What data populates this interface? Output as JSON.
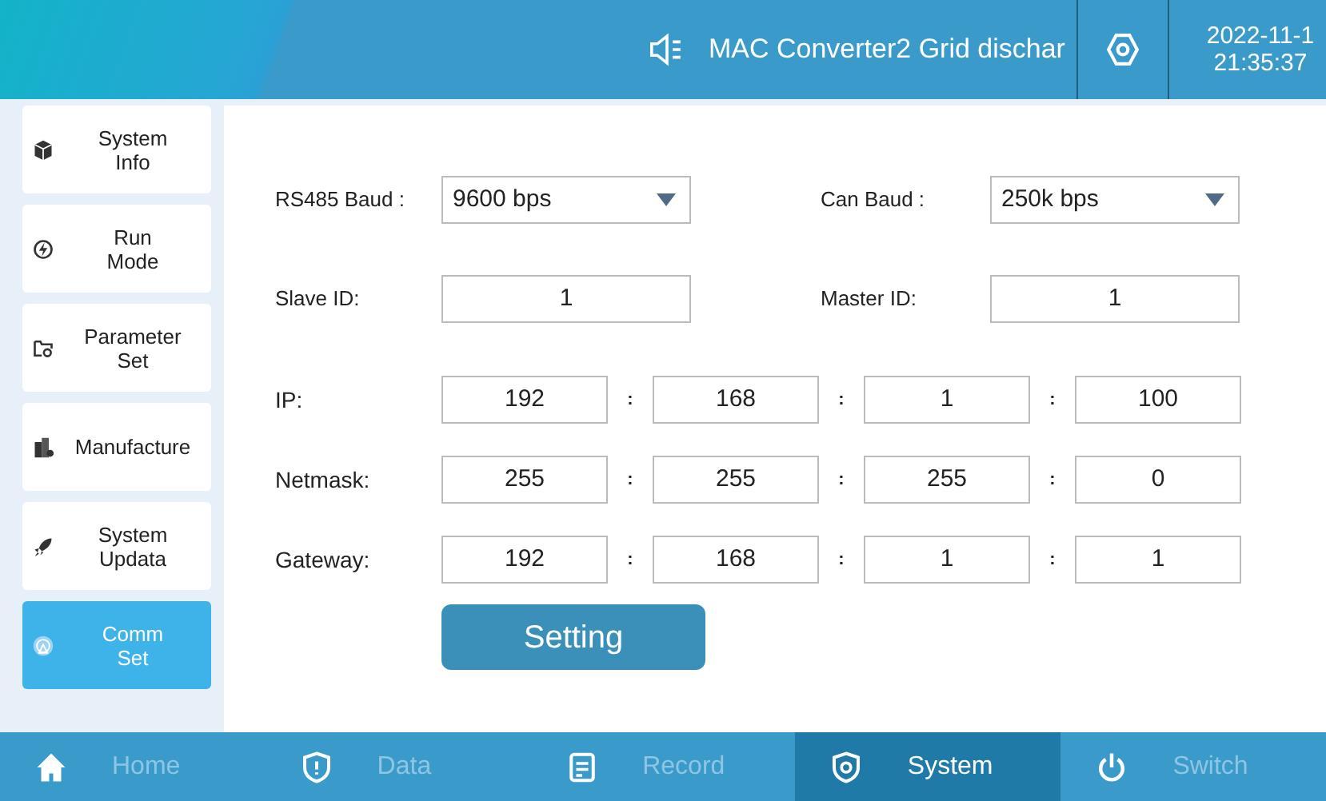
{
  "header": {
    "title": "MAC Converter2 Grid dischar",
    "date": "2022-11-1",
    "time": "21:35:37"
  },
  "sidebar": {
    "items": [
      {
        "label": "System\nInfo",
        "selected": false
      },
      {
        "label": "Run\nMode",
        "selected": false
      },
      {
        "label": "Parameter\nSet",
        "selected": false
      },
      {
        "label": "Manufacture",
        "selected": false
      },
      {
        "label": "System\nUpdata",
        "selected": false
      },
      {
        "label": "Comm\nSet",
        "selected": true
      }
    ]
  },
  "form": {
    "select_rows": [
      {
        "cells": [
          {
            "label": "RS485 Baud :",
            "kind": "select",
            "value": "9600 bps"
          },
          {
            "label": "Can Baud :",
            "kind": "select",
            "value": "250k bps"
          }
        ]
      },
      {
        "cells": [
          {
            "label": "Slave ID:",
            "kind": "input",
            "value": "1"
          },
          {
            "label": "Master ID:",
            "kind": "input",
            "value": "1"
          }
        ]
      }
    ],
    "address_rows": [
      {
        "label": "IP:",
        "parts": [
          "192",
          ":",
          "168",
          ":",
          "1",
          ":",
          "100"
        ]
      },
      {
        "label": "Netmask:",
        "parts": [
          "255",
          ":",
          "255",
          ":",
          "255",
          ":",
          "0"
        ]
      },
      {
        "label": "Gateway:",
        "parts": [
          "192",
          ":",
          "168",
          ":",
          "1",
          ":",
          "1"
        ]
      }
    ],
    "button": "Setting"
  },
  "bottom_nav": [
    {
      "label": "Home",
      "selected": false
    },
    {
      "label": "Data",
      "selected": false
    },
    {
      "label": "Record",
      "selected": false
    },
    {
      "label": "System",
      "selected": true
    },
    {
      "label": "Switch",
      "selected": false
    }
  ]
}
